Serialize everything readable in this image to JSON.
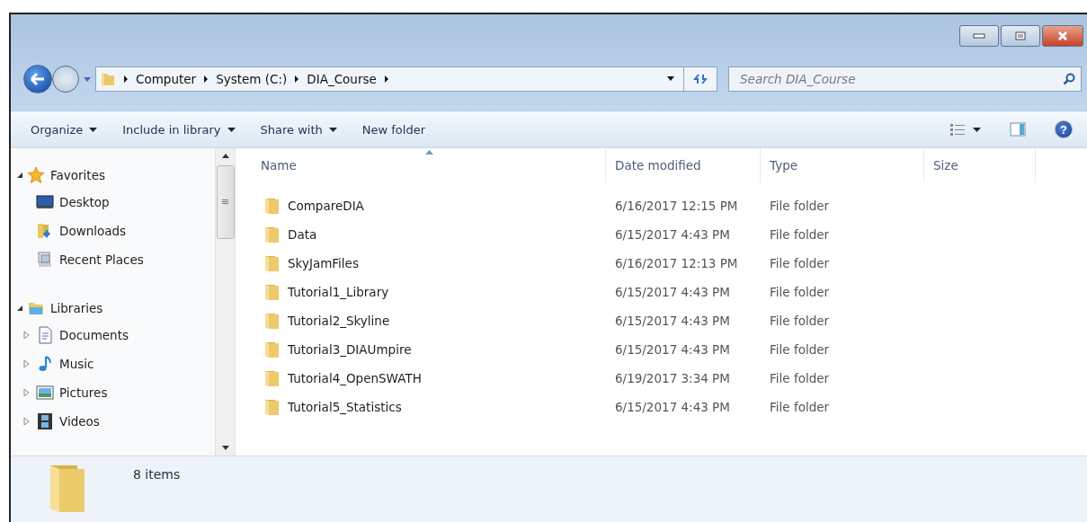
{
  "address": {
    "path": [
      "Computer",
      "System (C:)",
      "DIA_Course"
    ]
  },
  "search": {
    "placeholder": "Search DIA_Course"
  },
  "toolbar": [
    {
      "label": "Organize",
      "dropdown": true
    },
    {
      "label": "Include in library",
      "dropdown": true
    },
    {
      "label": "Share with",
      "dropdown": true
    },
    {
      "label": "New folder",
      "dropdown": false
    }
  ],
  "sidebar": {
    "groups": [
      {
        "label": "Favorites",
        "kind": "star",
        "expanded": true,
        "children": [
          {
            "label": "Desktop",
            "kind": "desktop"
          },
          {
            "label": "Downloads",
            "kind": "download"
          },
          {
            "label": "Recent Places",
            "kind": "recent"
          }
        ]
      },
      {
        "label": "Libraries",
        "kind": "library",
        "expanded": true,
        "children": [
          {
            "label": "Documents",
            "kind": "document",
            "expanded": false
          },
          {
            "label": "Music",
            "kind": "music",
            "expanded": false
          },
          {
            "label": "Pictures",
            "kind": "picture",
            "expanded": false
          },
          {
            "label": "Videos",
            "kind": "video",
            "expanded": false
          }
        ]
      }
    ]
  },
  "table": {
    "columns": [
      {
        "label": "Name",
        "sorted": true
      },
      {
        "label": "Date modified",
        "sorted": false
      },
      {
        "label": "Type",
        "sorted": false
      },
      {
        "label": "Size",
        "sorted": false
      }
    ],
    "rows": [
      {
        "name": "CompareDIA",
        "date": "6/16/2017 12:15 PM",
        "type": "File folder"
      },
      {
        "name": "Data",
        "date": "6/15/2017 4:43 PM",
        "type": "File folder"
      },
      {
        "name": "SkyJamFiles",
        "date": "6/16/2017 12:13 PM",
        "type": "File folder"
      },
      {
        "name": "Tutorial1_Library",
        "date": "6/15/2017 4:43 PM",
        "type": "File folder"
      },
      {
        "name": "Tutorial2_Skyline",
        "date": "6/15/2017 4:43 PM",
        "type": "File folder"
      },
      {
        "name": "Tutorial3_DIAUmpire",
        "date": "6/15/2017 4:43 PM",
        "type": "File folder"
      },
      {
        "name": "Tutorial4_OpenSWATH",
        "date": "6/19/2017 3:34 PM",
        "type": "File folder"
      },
      {
        "name": "Tutorial5_Statistics",
        "date": "6/15/2017 4:43 PM",
        "type": "File folder"
      }
    ]
  },
  "help_button": {
    "glyph": "?"
  },
  "status_bar": {
    "text": "8 items"
  }
}
